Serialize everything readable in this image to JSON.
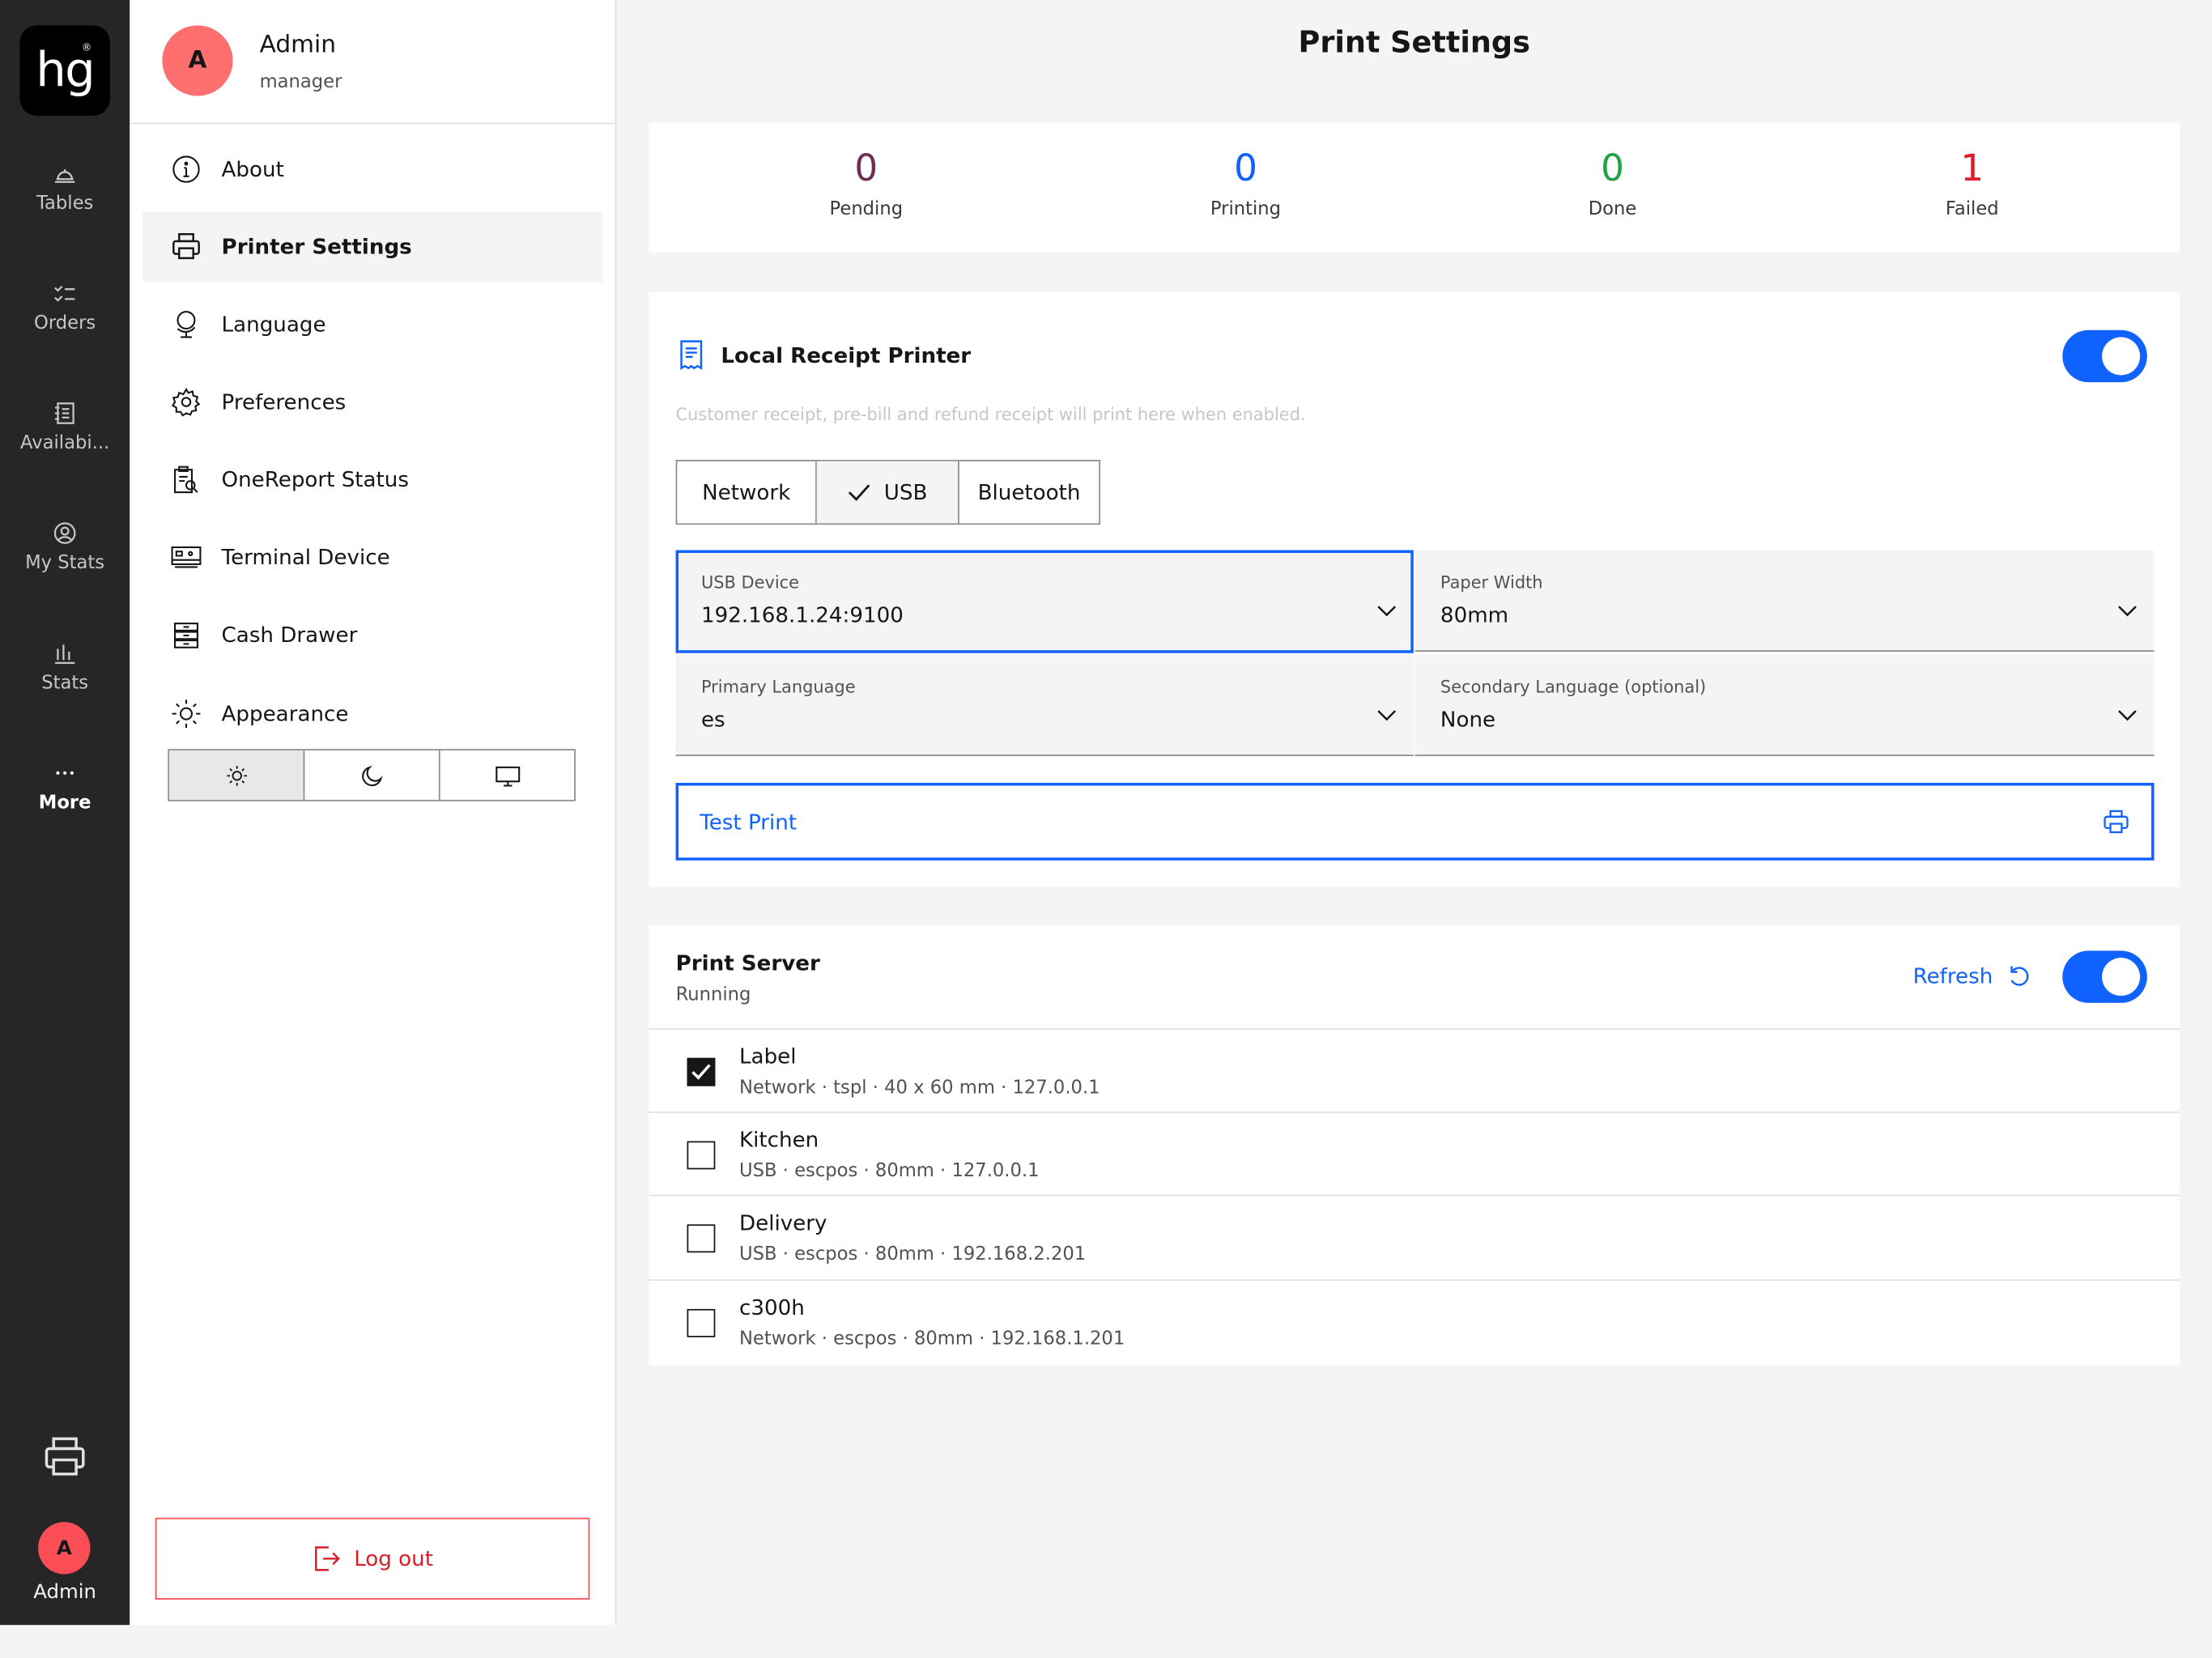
{
  "rail": {
    "logo": "hg",
    "logo_mark": "®",
    "items": [
      {
        "label": "Tables",
        "icon": "bell-icon"
      },
      {
        "label": "Orders",
        "icon": "list-checked-icon"
      },
      {
        "label": "Availabi...",
        "icon": "catalog-icon"
      },
      {
        "label": "My Stats",
        "icon": "user-avatar-icon"
      },
      {
        "label": "Stats",
        "icon": "bar-chart-icon"
      },
      {
        "label": "More",
        "icon": "overflow-icon"
      }
    ],
    "avatar_initial": "A",
    "user_label": "Admin"
  },
  "profile": {
    "initial": "A",
    "name": "Admin",
    "role": "manager"
  },
  "menu": [
    {
      "label": "About",
      "icon": "info-icon"
    },
    {
      "label": "Printer Settings",
      "icon": "printer-icon"
    },
    {
      "label": "Language",
      "icon": "globe-icon"
    },
    {
      "label": "Preferences",
      "icon": "gear-icon"
    },
    {
      "label": "OneReport Status",
      "icon": "report-icon"
    },
    {
      "label": "Terminal Device",
      "icon": "terminal-icon"
    },
    {
      "label": "Cash Drawer",
      "icon": "drawer-icon"
    },
    {
      "label": "Appearance",
      "icon": "sun-icon"
    }
  ],
  "logout_label": "Log out",
  "title": "Print Settings",
  "stats": [
    {
      "value": "0",
      "label": "Pending",
      "color": "#6f2f54"
    },
    {
      "value": "0",
      "label": "Printing",
      "color": "#0f62fe"
    },
    {
      "value": "0",
      "label": "Done",
      "color": "#24a148"
    },
    {
      "value": "1",
      "label": "Failed",
      "color": "#da1e28"
    }
  ],
  "local_printer": {
    "title": "Local Receipt Printer",
    "description": "Customer receipt, pre-bill and refund receipt will print here when enabled.",
    "connections": [
      "Network",
      "USB",
      "Bluetooth"
    ],
    "selected_connection": "USB",
    "usb_device_label": "USB Device",
    "usb_device_value": "192.168.1.24:9100",
    "paper_width_label": "Paper Width",
    "paper_width_value": "80mm",
    "primary_language_label": "Primary Language",
    "primary_language_value": "es",
    "secondary_language_label": "Secondary Language (optional)",
    "secondary_language_value": "None",
    "test_print_label": "Test Print"
  },
  "print_server": {
    "title": "Print Server",
    "status": "Running",
    "refresh_label": "Refresh",
    "printers": [
      {
        "name": "Label",
        "detail": "Network · tspl · 40 x 60 mm · 127.0.0.1",
        "checked": true
      },
      {
        "name": "Kitchen",
        "detail": "USB · escpos · 80mm · 127.0.0.1",
        "checked": false
      },
      {
        "name": "Delivery",
        "detail": "USB · escpos · 80mm · 192.168.2.201",
        "checked": false
      },
      {
        "name": "c300h",
        "detail": "Network · escpos · 80mm · 192.168.1.201",
        "checked": false
      }
    ]
  },
  "colors": {
    "accent": "#0f62fe",
    "danger": "#da1e28",
    "rail": "#262626"
  }
}
